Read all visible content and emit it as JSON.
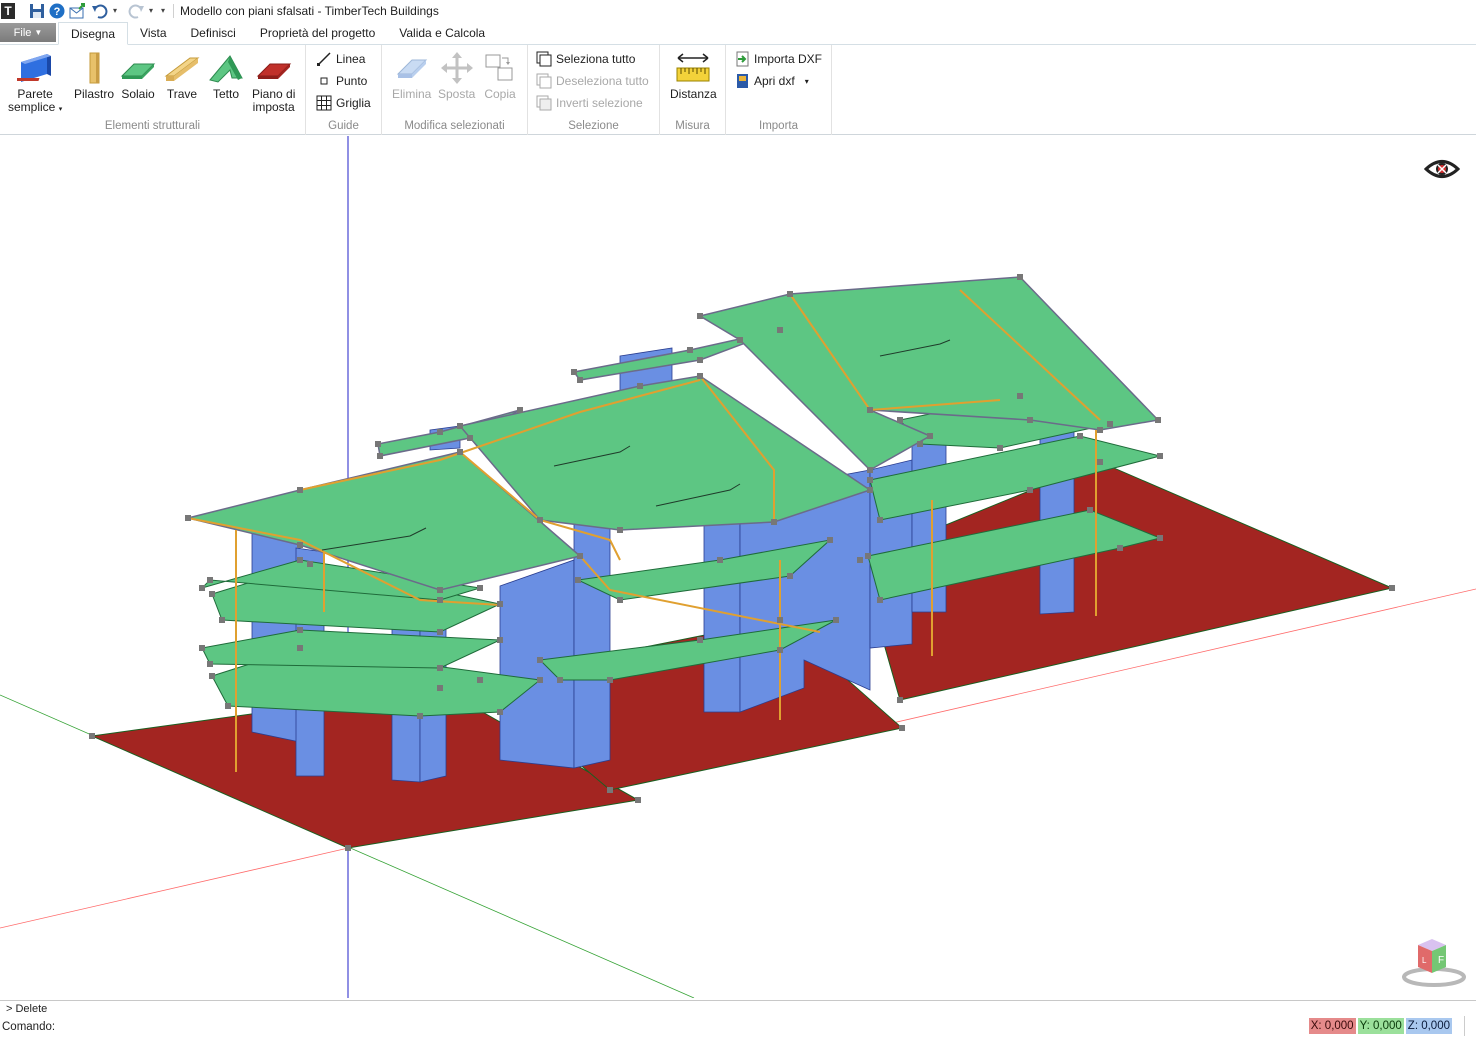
{
  "window": {
    "title": "Modello con piani sfalsati - TimberTech Buildings",
    "app_glyph": "T"
  },
  "quick_access": [
    "save-icon",
    "help-icon",
    "share-icon",
    "undo-icon",
    "redo-icon"
  ],
  "tabs": {
    "file": "File",
    "items": [
      "Disegna",
      "Vista",
      "Definisci",
      "Proprietà del progetto",
      "Valida e Calcola"
    ],
    "active": "Disegna"
  },
  "ribbon": {
    "structural": {
      "label": "Elementi strutturali",
      "parete_1": "Parete",
      "parete_2": "semplice",
      "pilastro": "Pilastro",
      "solaio": "Solaio",
      "trave": "Trave",
      "tetto": "Tetto",
      "piano_1": "Piano di",
      "piano_2": "imposta"
    },
    "guide": {
      "label": "Guide",
      "linea": "Linea",
      "punto": "Punto",
      "griglia": "Griglia"
    },
    "modify": {
      "label": "Modifica selezionati",
      "elimina": "Elimina",
      "sposta": "Sposta",
      "copia": "Copia"
    },
    "selection": {
      "label": "Selezione",
      "select_all": "Seleziona tutto",
      "deselect_all": "Deseleziona tutto",
      "invert": "Inverti selezione"
    },
    "measure": {
      "label": "Misura",
      "distance": "Distanza"
    },
    "import": {
      "label": "Importa",
      "import_dxf": "Importa DXF",
      "open_dxf": "Apri dxf"
    }
  },
  "command": {
    "history": "> Delete",
    "label": "Comando:",
    "value": ""
  },
  "coordinates": {
    "x": "X: 0,000",
    "y": "Y: 0,000",
    "z": "Z: 0,000"
  },
  "colors": {
    "slab": "#5dc683",
    "roof": "#5dc683",
    "wall": "#6a8fe3",
    "base_plane": "#a32521",
    "beam": "#e0a030",
    "node": "#777777",
    "axis_x": "#ff0000",
    "axis_y": "#00a000",
    "axis_z": "#0000ff"
  }
}
